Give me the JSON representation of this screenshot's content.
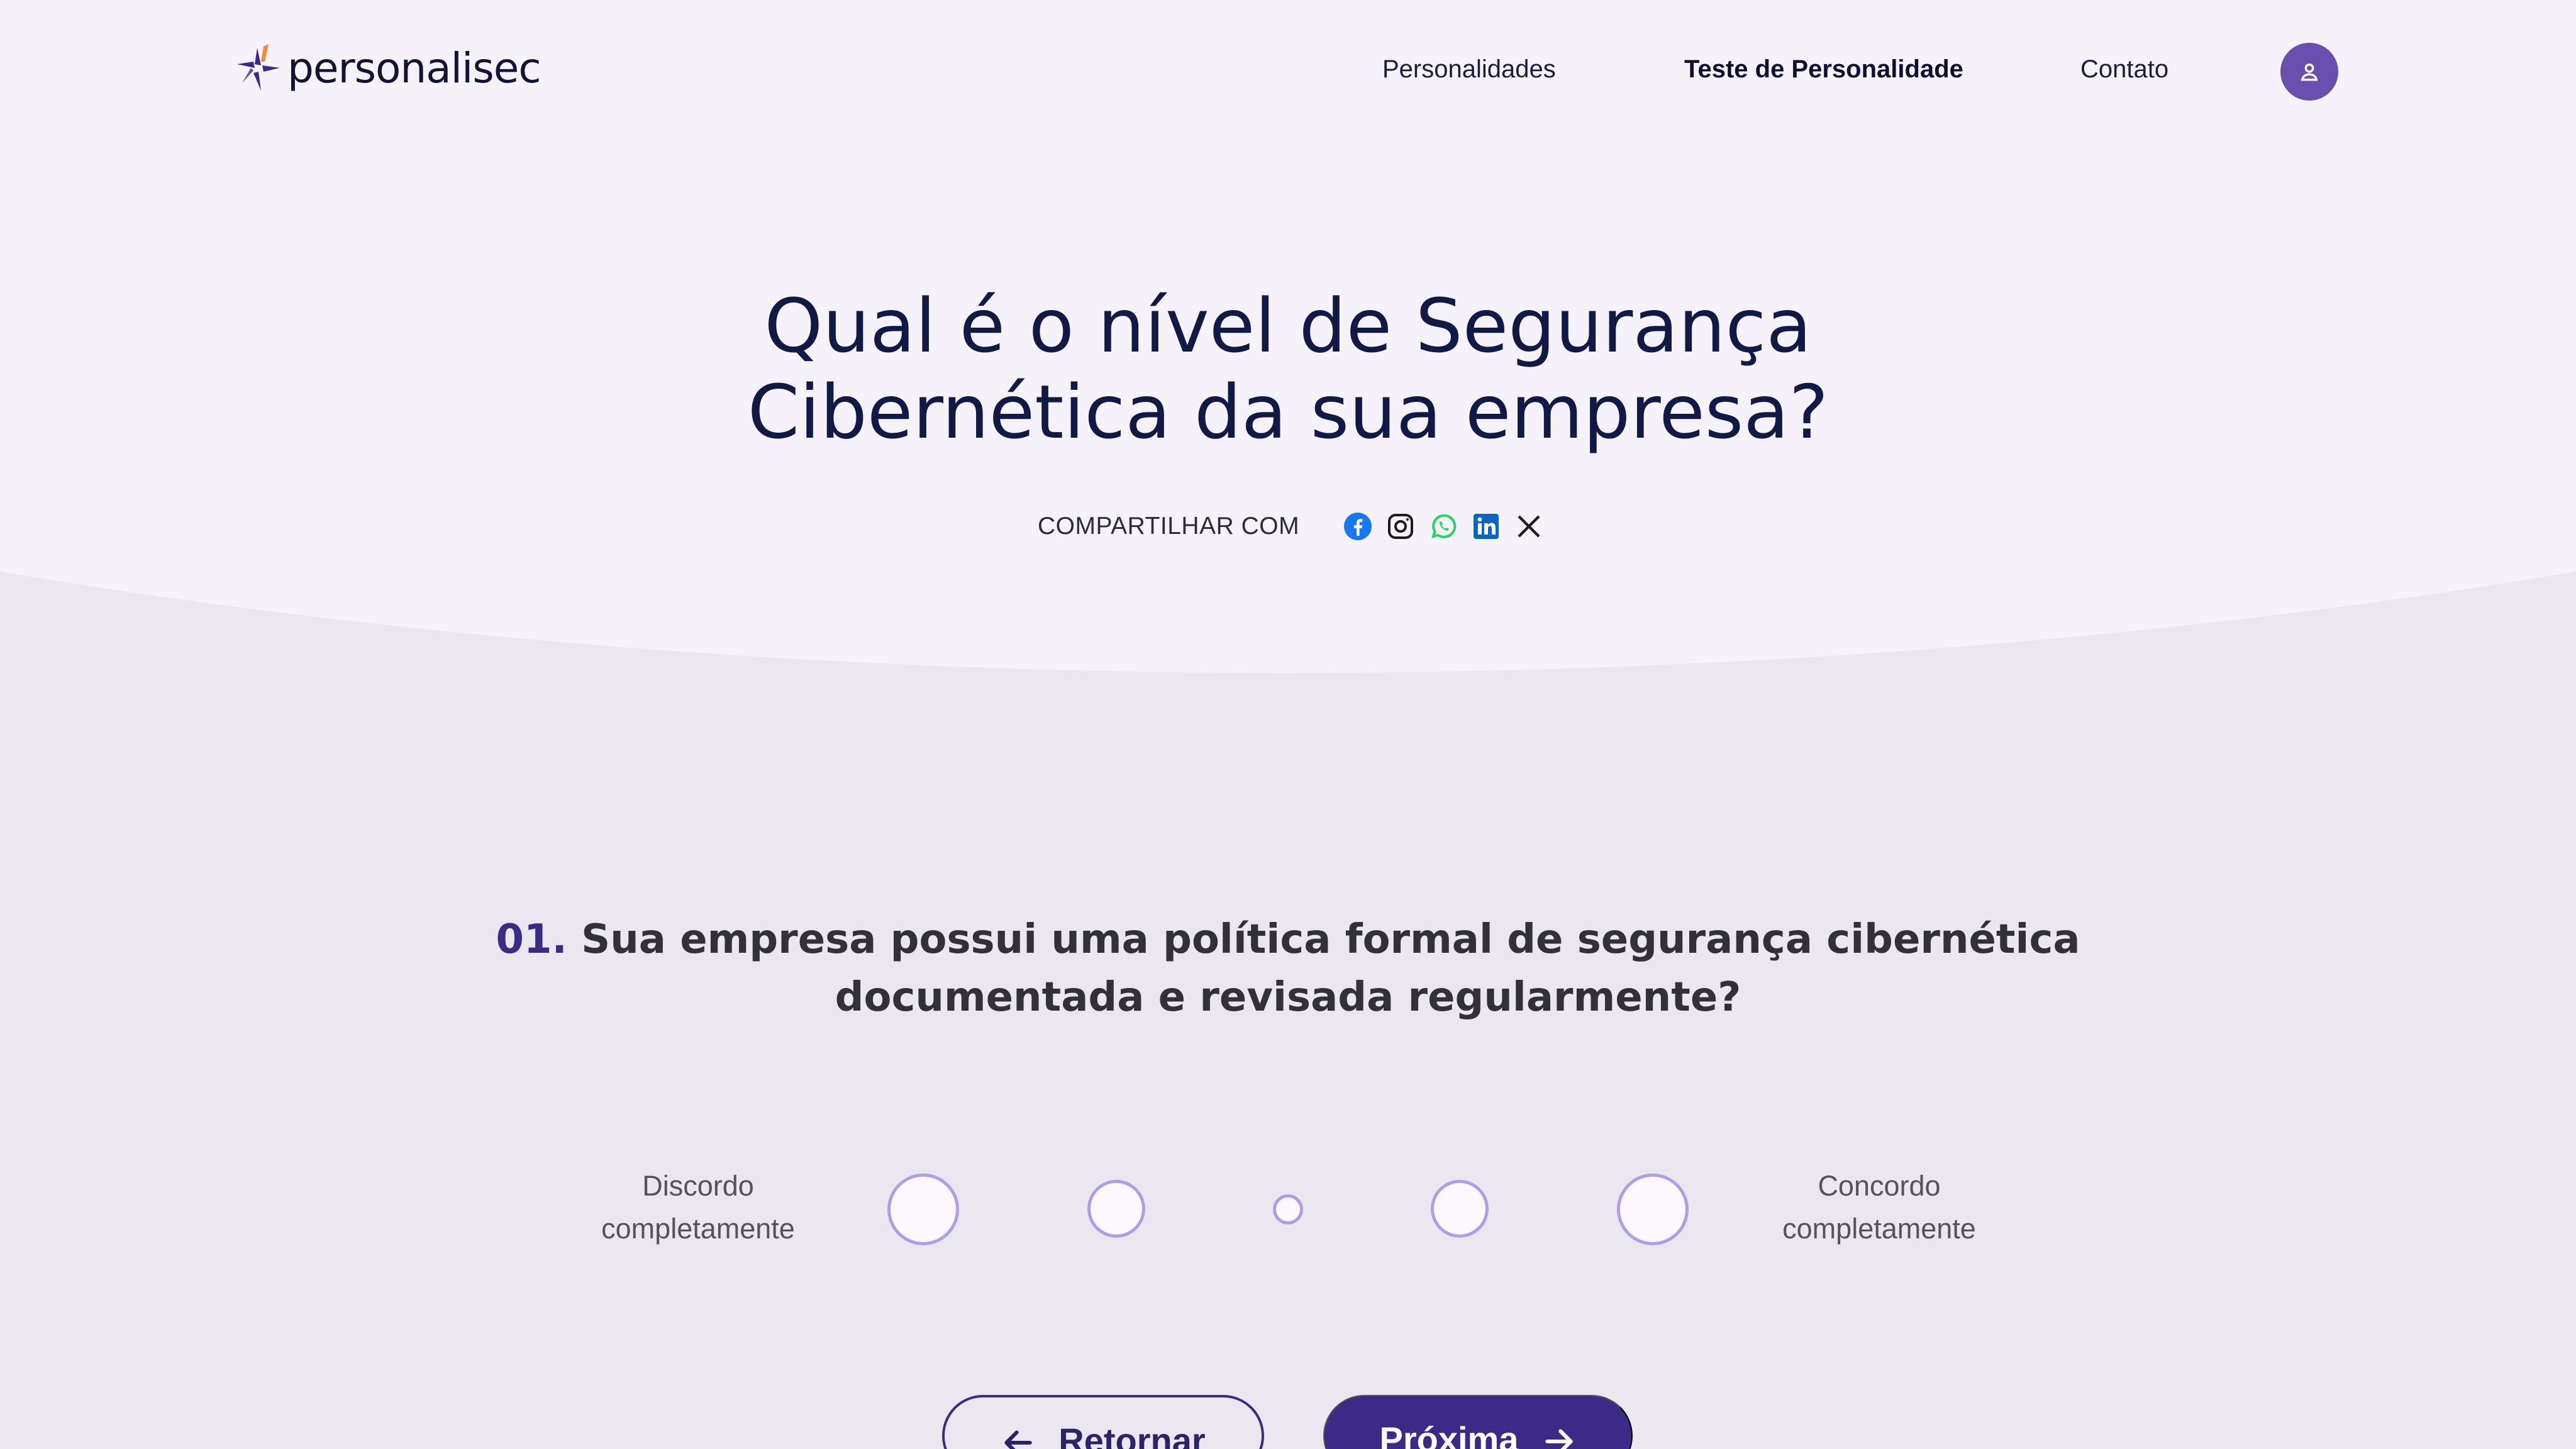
{
  "brand": {
    "name": "personalisec"
  },
  "nav": {
    "items": [
      {
        "label": "Personalidades"
      },
      {
        "label": "Teste de Personalidade",
        "active": true
      },
      {
        "label": "Contato"
      }
    ],
    "user_icon": "user-icon"
  },
  "hero": {
    "title_line1": "Qual é o nível de Segurança",
    "title_line2": "Cibernética da sua empresa?",
    "share_label": "COMPARTILHAR COM",
    "share_icons": [
      "facebook-icon",
      "instagram-icon",
      "whatsapp-icon",
      "linkedin-icon",
      "x-icon"
    ]
  },
  "question": {
    "number": "01.",
    "text_line1": "Sua empresa possui uma política formal de segurança cibernética",
    "text_line2": "documentada e revisada regularmente?"
  },
  "scale": {
    "left_line1": "Discordo",
    "left_line2": "completamente",
    "right_line1": "Concordo",
    "right_line2": "completamente",
    "options_count": 5
  },
  "buttons": {
    "back_label": "Retornar",
    "next_label": "Próxima"
  },
  "colors": {
    "primary": "#3b2a86",
    "accent": "#6b4fae",
    "option_border": "#b19ce6",
    "background": "#ebe7f0",
    "hero_background": "#f5f2f9"
  }
}
